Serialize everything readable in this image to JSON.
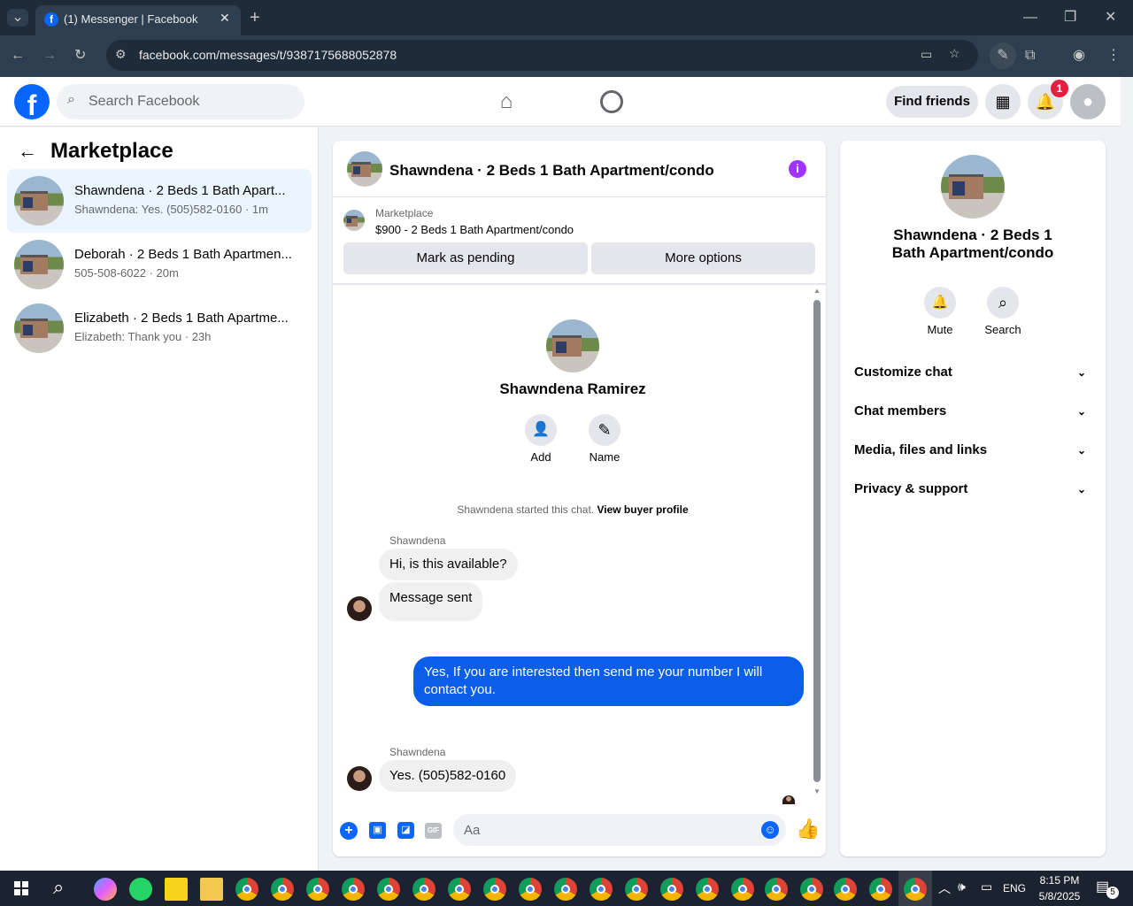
{
  "browser": {
    "tab_title": "(1) Messenger | Facebook",
    "url": "facebook.com/messages/t/9387175688052878"
  },
  "header": {
    "search_placeholder": "Search Facebook",
    "find_friends": "Find friends",
    "notification_count": "1"
  },
  "sidebar": {
    "title": "Marketplace",
    "conversations": [
      {
        "name": "Shawndena · 2 Beds 1 Bath Apart...",
        "preview": "Shawndena: Yes. (505)582-0160 · 1m"
      },
      {
        "name": "Deborah · 2 Beds 1 Bath Apartmen...",
        "preview": "505-508-6022 · 20m"
      },
      {
        "name": "Elizabeth · 2 Beds 1 Bath Apartme...",
        "preview": "Elizabeth: Thank you · 23h"
      }
    ]
  },
  "chat": {
    "title": "Shawndena · 2 Beds 1 Bath Apartment/condo",
    "listing_label": "Marketplace",
    "listing_detail": "$900 - 2 Beds 1 Bath Apartment/condo",
    "mark_pending": "Mark as pending",
    "more_options": "More options",
    "profile_name": "Shawndena Ramirez",
    "add_label": "Add",
    "name_label": "Name",
    "started_text": "Shawndena started this chat.",
    "view_buyer": "View buyer profile",
    "sender1": "Shawndena",
    "msg1": "Hi, is this available?",
    "msg2": "Message sent",
    "msg_out": "Yes, If you are interested then send me your number I will contact you.",
    "sender2": "Shawndena",
    "msg3": "Yes. (505)582-0160",
    "composer_placeholder": "Aa"
  },
  "details": {
    "title": "Shawndena · 2 Beds 1 Bath Apartment/condo",
    "mute": "Mute",
    "search": "Search",
    "rows": [
      "Customize chat",
      "Chat members",
      "Media, files and links",
      "Privacy & support"
    ]
  },
  "taskbar": {
    "lang": "ENG",
    "time": "8:15 PM",
    "date": "5/8/2025",
    "notif_count": "5"
  },
  "colors": {
    "accent": "#0a5ee9",
    "facebook_blue": "#0866ff",
    "info_purple": "#a033ff"
  }
}
